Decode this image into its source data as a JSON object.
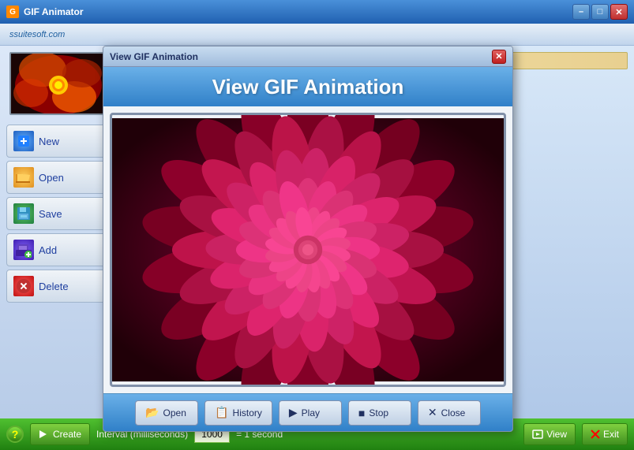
{
  "app": {
    "title": "GIF Animator",
    "logo_text": "ssuitesoft.com"
  },
  "title_bar": {
    "minimize_label": "–",
    "maximize_label": "□",
    "close_label": "✕"
  },
  "sidebar": {
    "buttons": [
      {
        "id": "new",
        "label": "New",
        "icon": "new-icon",
        "icon_char": "✦"
      },
      {
        "id": "open",
        "label": "Open",
        "icon": "open-icon",
        "icon_char": "📂"
      },
      {
        "id": "save",
        "label": "Save",
        "icon": "save-icon",
        "icon_char": "💾"
      },
      {
        "id": "add",
        "label": "Add",
        "icon": "add-icon",
        "icon_char": "🖥"
      },
      {
        "id": "delete",
        "label": "Delete",
        "icon": "delete-icon",
        "icon_char": "✕"
      }
    ]
  },
  "status_bar": {
    "help_char": "?",
    "create_label": "Create",
    "interval_label": "Interval (milliseconds)",
    "interval_value": "1000",
    "second_label": "= 1 second",
    "view_label": "View",
    "exit_label": "Exit",
    "exit_icon": "✕"
  },
  "modal": {
    "title": "View GIF Animation",
    "header_text": "View GIF Animation",
    "close_btn": "✕",
    "buttons": [
      {
        "id": "open",
        "label": "Open",
        "icon": "📂"
      },
      {
        "id": "history",
        "label": "History",
        "icon": "📋"
      },
      {
        "id": "play",
        "label": "Play",
        "icon": "▶"
      },
      {
        "id": "stop",
        "label": "Stop",
        "icon": "■"
      },
      {
        "id": "close",
        "label": "Close",
        "icon": "✕"
      }
    ]
  }
}
